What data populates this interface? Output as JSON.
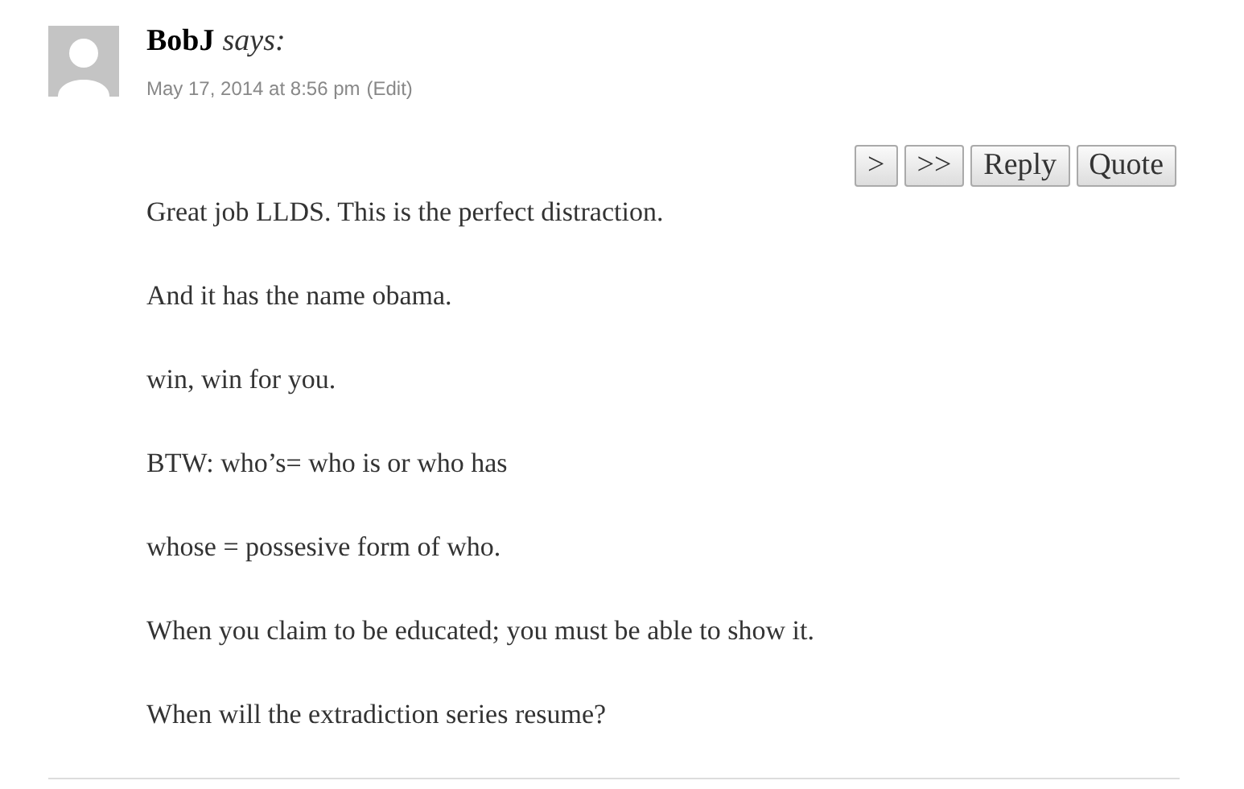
{
  "comment": {
    "author": "BobJ",
    "says": "says:",
    "date": "May 17, 2014 at 8:56 pm",
    "edit": "(Edit)",
    "buttons": [
      ">",
      ">>",
      "Reply",
      "Quote"
    ],
    "paragraphs": [
      "Great job LLDS. This is the perfect distraction.",
      "And it has the name obama.",
      "win, win for you.",
      "BTW: who’s= who is or who has",
      "whose = possesive form of who.",
      "When you claim to be educated; you must be able to show it.",
      "When will the extradiction series resume?"
    ]
  }
}
